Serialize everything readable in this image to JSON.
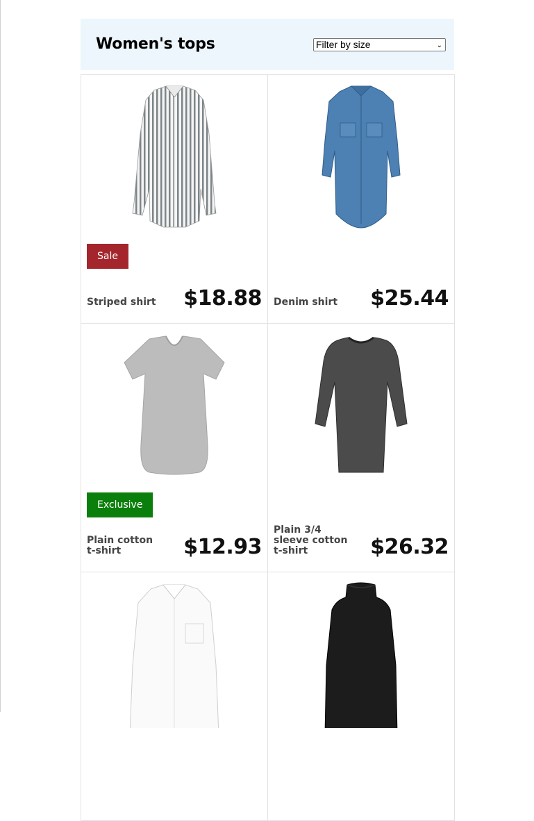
{
  "header": {
    "title": "Women's tops",
    "filter": {
      "selected": "Filter by size"
    }
  },
  "products": [
    {
      "name": "Striped shirt",
      "price": "$18.88",
      "badge": "Sale",
      "image_icon": "striped-shirt-icon",
      "color": "#8c9396"
    },
    {
      "name": "Denim shirt",
      "price": "$25.44",
      "badge": "",
      "image_icon": "denim-shirt-icon",
      "color": "#4a7fb5"
    },
    {
      "name": "Plain cotton t-shirt",
      "price": "$12.93",
      "badge": "Exclusive",
      "image_icon": "gray-tshirt-icon",
      "color": "#bdbdbd"
    },
    {
      "name": "Plain 3/4 sleeve cotton t-shirt",
      "price": "$26.32",
      "badge": "",
      "image_icon": "charcoal-longsleeve-icon",
      "color": "#4a4a4a"
    },
    {
      "name": "",
      "price": "",
      "badge": "",
      "image_icon": "white-shirt-icon",
      "color": "#ffffff"
    },
    {
      "name": "",
      "price": "",
      "badge": "",
      "image_icon": "black-turtleneck-icon",
      "color": "#1a1a1a"
    }
  ],
  "colors": {
    "sale": "#a4262c",
    "exclusive": "#0b7f0b",
    "header_bg": "#eef6fd"
  }
}
